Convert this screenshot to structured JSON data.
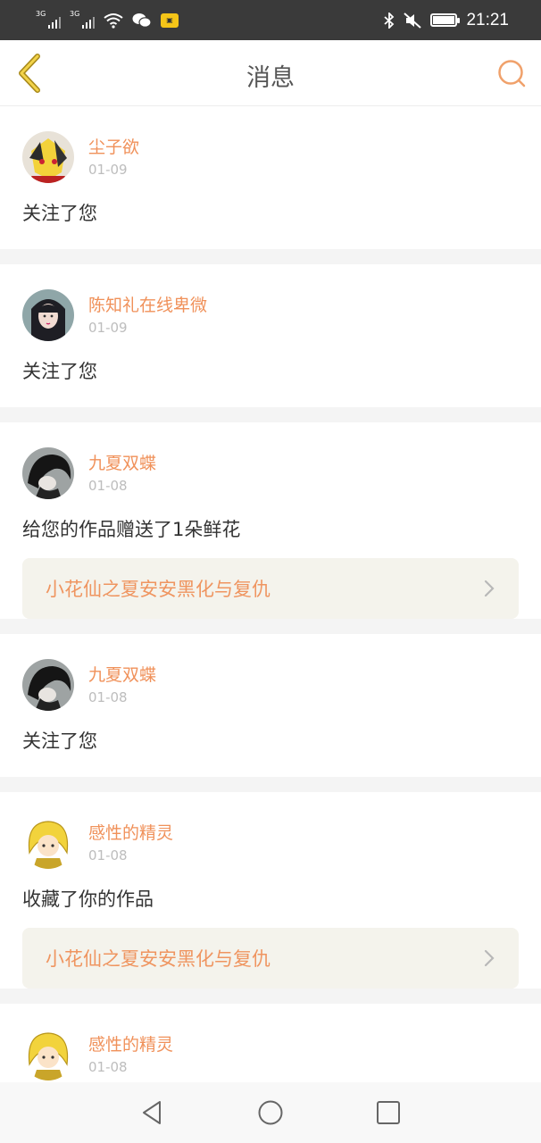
{
  "status_bar": {
    "sim1_tag": "3G",
    "sim2_tag": "3G",
    "time": "21:21",
    "icons": [
      "signal-icon",
      "wifi-icon",
      "wechat-icon",
      "app-badge-icon",
      "bluetooth-icon",
      "mute-icon",
      "battery-icon"
    ]
  },
  "header": {
    "title": "消息",
    "back_icon": "chevron-left-icon",
    "search_icon": "search-icon",
    "accent": "#f0a16b"
  },
  "feed": [
    {
      "username": "尘子欲",
      "date": "01-09",
      "action": "关注了您",
      "avatar": "anime-avatar-icon"
    },
    {
      "username": "陈知礼在线卑微",
      "date": "01-09",
      "action": "关注了您",
      "avatar": "girl-avatar-icon"
    },
    {
      "username": "九夏双蝶",
      "date": "01-08",
      "action": "给您的作品赠送了1朵鲜花",
      "work_title": "小花仙之夏安安黑化与复仇",
      "avatar": "dark-avatar-icon"
    },
    {
      "username": "九夏双蝶",
      "date": "01-08",
      "action": "关注了您",
      "avatar": "dark-avatar-icon"
    },
    {
      "username": "感性的精灵",
      "date": "01-08",
      "action": "收藏了你的作品",
      "work_title": "小花仙之夏安安黑化与复仇",
      "avatar": "blonde-avatar-icon"
    },
    {
      "username": "感性的精灵",
      "date": "01-08",
      "action": "",
      "avatar": "blonde-avatar-icon"
    }
  ],
  "colors": {
    "username": "#f0915a",
    "work_title": "#ef9560",
    "work_bg": "#f4f3ec",
    "status_bar_bg": "#3a3a3a"
  },
  "nav_bar": {
    "icons": [
      "back-triangle-icon",
      "home-circle-icon",
      "recents-square-icon"
    ]
  }
}
